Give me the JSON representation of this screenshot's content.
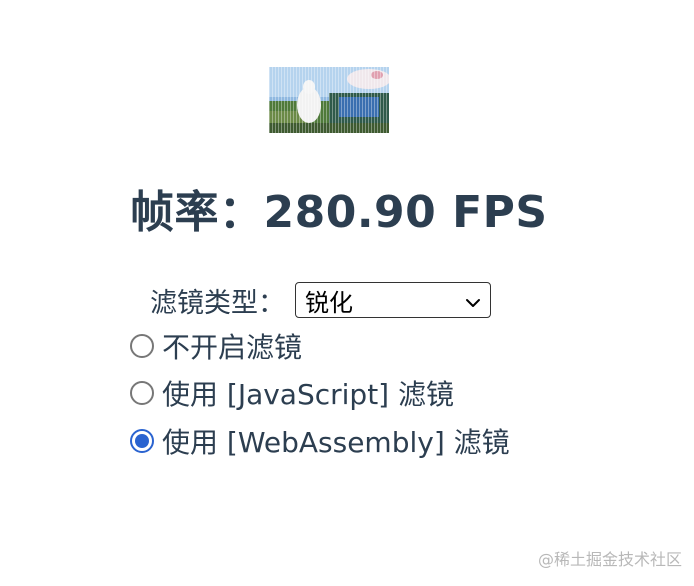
{
  "fps": {
    "label": "帧率：",
    "value": "280.90 FPS"
  },
  "filter": {
    "label": "滤镜类型：",
    "selected": "锐化"
  },
  "options": [
    {
      "label": "不开启滤镜",
      "checked": false
    },
    {
      "label": "使用 [JavaScript] 滤镜",
      "checked": false
    },
    {
      "label": "使用 [WebAssembly] 滤镜",
      "checked": true
    }
  ],
  "watermark": "@稀土掘金技术社区",
  "colors": {
    "text": "#2c3e50",
    "radio_checked": "#2a63d0"
  }
}
